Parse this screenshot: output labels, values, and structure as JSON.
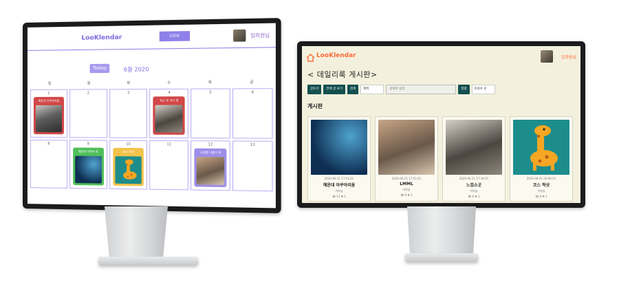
{
  "calendar": {
    "logo": "LooKlendar",
    "look_button": "LOOK",
    "user": "임희원님",
    "today_button": "Today",
    "month": "6월 2020",
    "weekdays": [
      "일",
      "월",
      "화",
      "수",
      "목",
      "금"
    ],
    "weeks": [
      [
        {
          "date": "1",
          "card_title": "해운대 아쿠아리움",
          "card_color": "#d24748"
        },
        {
          "date": "2"
        },
        {
          "date": "3"
        },
        {
          "date": "4",
          "card_title": "퇴근 후 코디 룩",
          "card_color": "#d24748"
        },
        {
          "date": "5"
        },
        {
          "date": "6"
        }
      ],
      [
        {
          "date": "8"
        },
        {
          "date": "9",
          "card_title": "해운대 아쿠아 룩",
          "card_color": "#4fbf5a"
        },
        {
          "date": "10",
          "card_title": "코스 착샷",
          "card_color": "#f2c24b"
        },
        {
          "date": "11"
        },
        {
          "date": "12",
          "card_title": "쇼핑몰 나들이 룩",
          "card_color": "#9d8eea"
        },
        {
          "date": "13"
        }
      ]
    ]
  },
  "board": {
    "logo": "LooKlendar",
    "user": "임희원님",
    "title": "< 데일리룩 게시판>",
    "toolbar": {
      "write": "글쓰기",
      "view_all": "전체 글 보기",
      "search": "검색",
      "search_type": "제목",
      "search_placeholder": "검색어 입력",
      "sort": "정렬",
      "sort_value": "조회수 순"
    },
    "section_title": "게시판",
    "posts": [
      {
        "date": "2020-06-21 17:51:01",
        "title": "해운대 아쿠아리움",
        "author": "이하늘",
        "stats": "👁 12 ❤ 1"
      },
      {
        "date": "2020-06-21 17:51:01",
        "title": "LMML",
        "author": "이하늘",
        "stats": "👁 6 ❤ 1"
      },
      {
        "date": "2020-06-21 17:18:01",
        "title": "느낌소굿",
        "author": "이하늘",
        "stats": "👁 8 ❤ 1"
      },
      {
        "date": "2020-06-21 20:06:23",
        "title": "코스 착샷",
        "author": "이하늘",
        "stats": "👁 8 ❤ 1"
      }
    ]
  },
  "colors": {
    "calendar_accent": "#8f80ea",
    "board_background": "#f3f1dd",
    "board_button": "#134f4f",
    "logo_orange": "#ff6a3d"
  }
}
